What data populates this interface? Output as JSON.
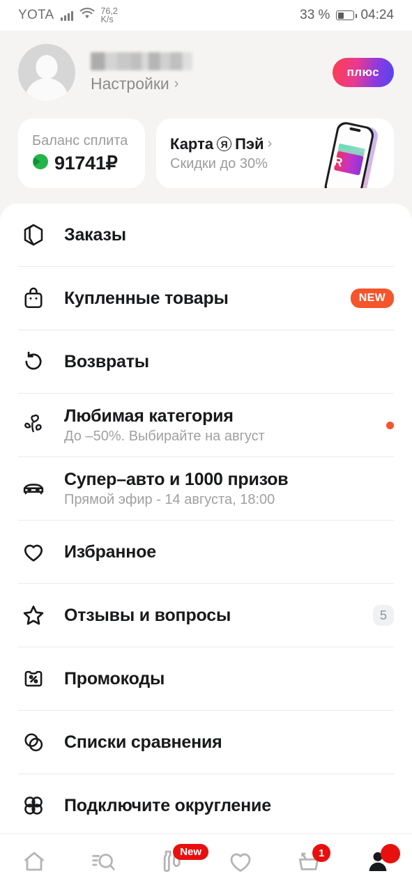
{
  "statusbar": {
    "carrier": "YOTA",
    "signal_icon": "signal-bars-icon",
    "wifi_icon": "wifi-icon",
    "speed_value": "76,2",
    "speed_unit": "K/s",
    "battery_percent": "33 %",
    "battery_icon": "battery-icon",
    "time": "04:24"
  },
  "profile": {
    "avatar_icon": "avatar-placeholder-icon",
    "name_masked": "",
    "settings_label": "Настройки",
    "settings_chevron": "chevron-right-icon",
    "plus_label": "плюс"
  },
  "cards": {
    "split": {
      "title": "Баланс сплита",
      "icon": "split-balance-icon",
      "amount": "91741₽"
    },
    "pay": {
      "title_prefix": "Карта",
      "brand_mark": "Я",
      "title_suffix": "Пэй",
      "chevron": "chevron-right-icon",
      "subtitle": "Скидки до 30%",
      "art_icon": "phone-with-card-illustration"
    }
  },
  "menu": {
    "items": [
      {
        "icon": "box-icon",
        "label": "Заказы",
        "sub": "",
        "badge": "",
        "badge_type": "none"
      },
      {
        "icon": "shopping-bag-icon",
        "label": "Купленные товары",
        "sub": "",
        "badge": "NEW",
        "badge_type": "new"
      },
      {
        "icon": "return-arrow-icon",
        "label": "Возвраты",
        "sub": "",
        "badge": "",
        "badge_type": "none"
      },
      {
        "icon": "clover-hearts-icon",
        "label": "Любимая категория",
        "sub": "До –50%. Выбирайте на август",
        "badge": "",
        "badge_type": "dot"
      },
      {
        "icon": "car-icon",
        "label": "Супер–авто и 1000 призов",
        "sub": "Прямой эфир - 14 августа, 18:00",
        "badge": "",
        "badge_type": "none"
      },
      {
        "icon": "heart-icon",
        "label": "Избранное",
        "sub": "",
        "badge": "",
        "badge_type": "none"
      },
      {
        "icon": "star-icon",
        "label": "Отзывы и вопросы",
        "sub": "",
        "badge": "5",
        "badge_type": "count"
      },
      {
        "icon": "percent-ticket-icon",
        "label": "Промокоды",
        "sub": "",
        "badge": "",
        "badge_type": "none"
      },
      {
        "icon": "compare-circles-icon",
        "label": "Списки сравнения",
        "sub": "",
        "badge": "",
        "badge_type": "none"
      },
      {
        "icon": "rounding-knot-icon",
        "label": "Подключите округление",
        "sub": "",
        "badge": "",
        "badge_type": "none"
      }
    ]
  },
  "bottomnav": {
    "items": [
      {
        "icon": "home-icon",
        "badge": "",
        "badge_type": "none",
        "active": false
      },
      {
        "icon": "search-catalog-icon",
        "badge": "",
        "badge_type": "none",
        "active": false
      },
      {
        "icon": "bottle-icon",
        "badge": "New",
        "badge_type": "new",
        "active": false
      },
      {
        "icon": "heart-icon",
        "badge": "",
        "badge_type": "none",
        "active": false
      },
      {
        "icon": "cart-icon",
        "badge": "1",
        "badge_type": "num",
        "active": false
      },
      {
        "icon": "profile-icon",
        "badge": "",
        "badge_type": "dot",
        "active": true
      }
    ]
  },
  "colors": {
    "accent_red": "#e8100f",
    "badge_new": "#f5552b",
    "split_green": "#24b54a",
    "page_bg": "#f5f4f2",
    "card_bg": "#ffffff",
    "text_primary": "#18191b",
    "text_muted": "#9b9b9b"
  }
}
